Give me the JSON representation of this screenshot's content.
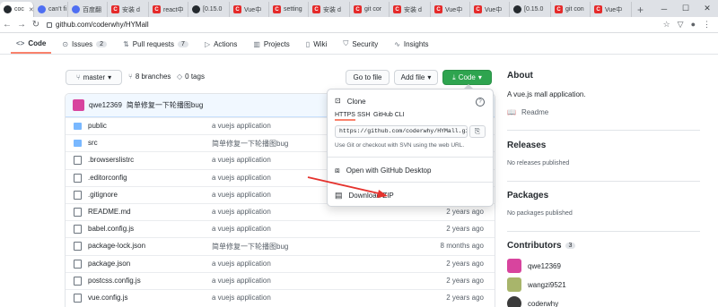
{
  "browser": {
    "tabs": [
      {
        "label": "coc",
        "icon": "github-icon",
        "active": true
      },
      {
        "label": "can't fi",
        "icon": "globe-icon"
      },
      {
        "label": "百度翻",
        "icon": "baidu-icon"
      },
      {
        "label": "安装 d",
        "icon": "csdn-icon"
      },
      {
        "label": "react中",
        "icon": "csdn-icon"
      },
      {
        "label": "[0.15.0",
        "icon": "github-icon"
      },
      {
        "label": "Vue中",
        "icon": "csdn-icon"
      },
      {
        "label": "setting",
        "icon": "csdn-icon"
      },
      {
        "label": "安装 d",
        "icon": "csdn-icon"
      },
      {
        "label": "git cor",
        "icon": "csdn-icon"
      },
      {
        "label": "安装 d",
        "icon": "csdn-icon"
      },
      {
        "label": "Vue中",
        "icon": "csdn-icon"
      },
      {
        "label": "Vue中",
        "icon": "csdn-icon"
      },
      {
        "label": "[0.15.0",
        "icon": "github-icon"
      },
      {
        "label": "git con",
        "icon": "csdn-icon"
      },
      {
        "label": "Vue中",
        "icon": "csdn-icon"
      }
    ],
    "new_tab": "+",
    "url": "github.com/coderwhy/HYMall"
  },
  "repo_nav": [
    {
      "label": "Code",
      "icon": "code-icon",
      "active": true
    },
    {
      "label": "Issues",
      "icon": "issue-icon",
      "count": "2"
    },
    {
      "label": "Pull requests",
      "icon": "pull-request-icon",
      "count": "7"
    },
    {
      "label": "Actions",
      "icon": "play-icon"
    },
    {
      "label": "Projects",
      "icon": "project-icon"
    },
    {
      "label": "Wiki",
      "icon": "book-icon"
    },
    {
      "label": "Security",
      "icon": "shield-icon"
    },
    {
      "label": "Insights",
      "icon": "graph-icon"
    }
  ],
  "toolbar": {
    "branch": "master",
    "branches": "8 branches",
    "tags": "0 tags",
    "go_to_file": "Go to file",
    "add_file": "Add file",
    "code": "Code"
  },
  "commit": {
    "author": "qwe12369",
    "message": "简单修复一下轮播图bug"
  },
  "files": [
    {
      "name": "public",
      "type": "dir",
      "message": "a vuejs application",
      "age": ""
    },
    {
      "name": "src",
      "type": "dir",
      "message": "简单修复一下轮播图bug",
      "age": ""
    },
    {
      "name": ".browserslistrc",
      "type": "file",
      "message": "a vuejs application",
      "age": ""
    },
    {
      "name": ".editorconfig",
      "type": "file",
      "message": "a vuejs application",
      "age": ""
    },
    {
      "name": ".gitignore",
      "type": "file",
      "message": "a vuejs application",
      "age": "2 years ago"
    },
    {
      "name": "README.md",
      "type": "file",
      "message": "a vuejs application",
      "age": "2 years ago"
    },
    {
      "name": "babel.config.js",
      "type": "file",
      "message": "a vuejs application",
      "age": "2 years ago"
    },
    {
      "name": "package-lock.json",
      "type": "file",
      "message": "简单修复一下轮播图bug",
      "age": "8 months ago"
    },
    {
      "name": "package.json",
      "type": "file",
      "message": "a vuejs application",
      "age": "2 years ago"
    },
    {
      "name": "postcss.config.js",
      "type": "file",
      "message": "a vuejs application",
      "age": "2 years ago"
    },
    {
      "name": "vue.config.js",
      "type": "file",
      "message": "a vuejs application",
      "age": "2 years ago"
    }
  ],
  "clone": {
    "title": "Clone",
    "tabs": [
      "HTTPS",
      "SSH",
      "GitHub CLI"
    ],
    "url": "https://github.com/coderwhy/HYMall.git",
    "hint": "Use Git or checkout with SVN using the web URL.",
    "desktop": "Open with GitHub Desktop",
    "zip": "Download ZIP"
  },
  "sidebar": {
    "about_title": "About",
    "about_desc": "A vue.js mall application.",
    "readme": "Readme",
    "releases_title": "Releases",
    "releases_empty": "No releases published",
    "packages_title": "Packages",
    "packages_empty": "No packages published",
    "contributors_title": "Contributors",
    "contributors_count": "3",
    "contributors": [
      "qwe12369",
      "wangzi9521",
      "coderwhy"
    ]
  },
  "colors": {
    "accent_green": "#2ea44f",
    "tab_underline": "#f9826c",
    "annotation_arrow": "#e5322d"
  }
}
